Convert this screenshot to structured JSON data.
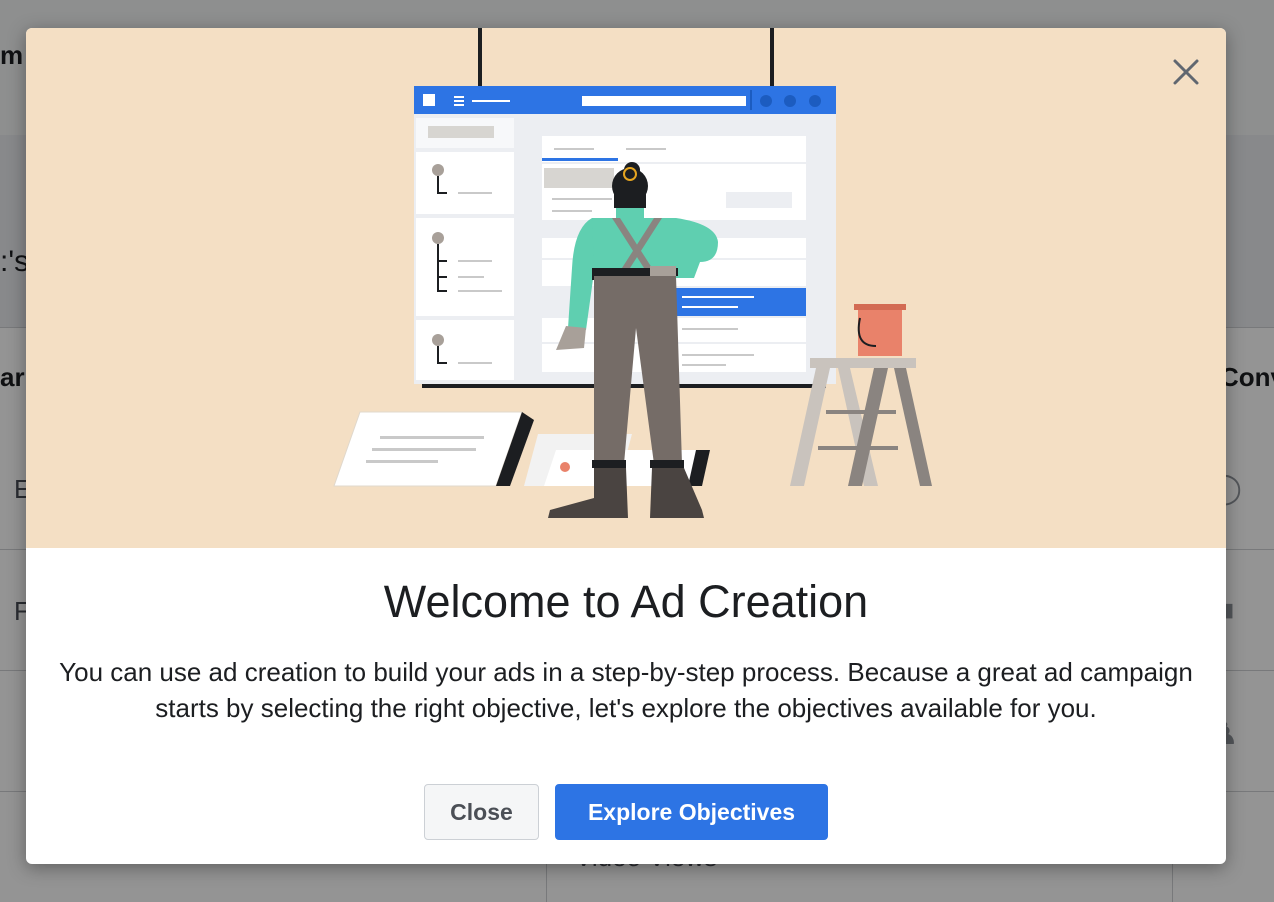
{
  "background": {
    "title_fragment": "m",
    "heading_fragment": ":'s",
    "column_fragment": "ar",
    "column2_fragment": "Conv",
    "row_fragments": [
      "E",
      "F"
    ],
    "bottom_fragment": "Video Views"
  },
  "dialog": {
    "title": "Welcome to Ad Creation",
    "body": "You can use ad creation to build your ads in a step-by-step process. Because a great ad campaign starts by selecting the right objective, let's explore the objectives available for you.",
    "close_label": "Close",
    "explore_label": "Explore Objectives",
    "close_icon": "close-icon",
    "illustration": "ad-creation-illustration"
  },
  "colors": {
    "hero_bg": "#f4dfc4",
    "primary": "#2d74e4",
    "text": "#1c1e21"
  }
}
